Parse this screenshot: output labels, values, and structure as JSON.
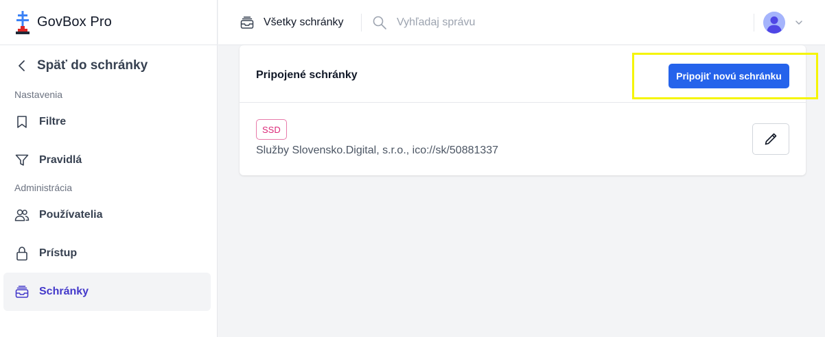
{
  "brand": {
    "name": "GovBox Pro",
    "logo_icon": "govbox-cross-logo"
  },
  "sidebar": {
    "back_label": "Späť do schránky",
    "sections": [
      {
        "label": "Nastavenia",
        "items": [
          {
            "label": "Filtre",
            "icon": "bookmark-icon"
          },
          {
            "label": "Pravidlá",
            "icon": "funnel-icon"
          }
        ]
      },
      {
        "label": "Administrácia",
        "items": [
          {
            "label": "Používatelia",
            "icon": "users-icon"
          },
          {
            "label": "Prístup",
            "icon": "lock-icon"
          },
          {
            "label": "Schránky",
            "icon": "inbox-icon",
            "active": true
          }
        ]
      }
    ]
  },
  "topbar": {
    "mailbox_label": "Všetky schránky",
    "search_placeholder": "Vyhľadaj správu",
    "search_value": ""
  },
  "card": {
    "title": "Pripojené schránky",
    "connect_button": "Pripojiť novú schránku",
    "boxes": [
      {
        "badge": "SSD",
        "name": "Služby Slovensko.Digital, s.r.o., ico://sk/50881337"
      }
    ]
  },
  "colors": {
    "primary": "#2563eb",
    "active_nav": "#4338ca",
    "badge": "#db2777",
    "highlight": "#f5f500"
  }
}
